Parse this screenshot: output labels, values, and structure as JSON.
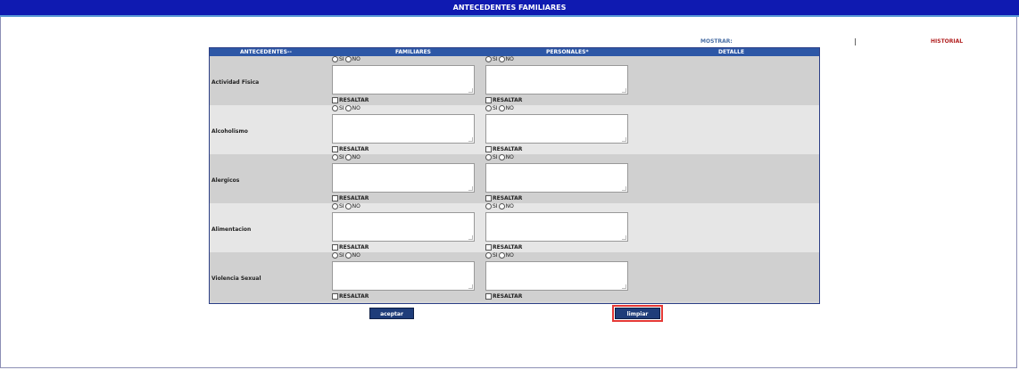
{
  "window": {
    "title": "ANTECEDENTES FAMILIARES"
  },
  "links": {
    "mostrar": "MOSTRAR:",
    "historial": "HISTORIAL"
  },
  "table": {
    "headers": {
      "antecedentes": "ANTECEDENTES--",
      "familiares": "FAMILIARES",
      "personales": "PERSONALES*",
      "detalle": "DETALLE"
    },
    "rows": [
      {
        "label": "Actividad Fisica"
      },
      {
        "label": "Alcoholismo"
      },
      {
        "label": "Alergicos"
      },
      {
        "label": "Alimentacion"
      },
      {
        "label": "Violencia Sexual"
      }
    ],
    "options": {
      "si": "SI",
      "no": "NO"
    },
    "resaltar": "RESALTAR"
  },
  "buttons": {
    "aceptar": "aceptar",
    "limpiar": "limpiar"
  }
}
